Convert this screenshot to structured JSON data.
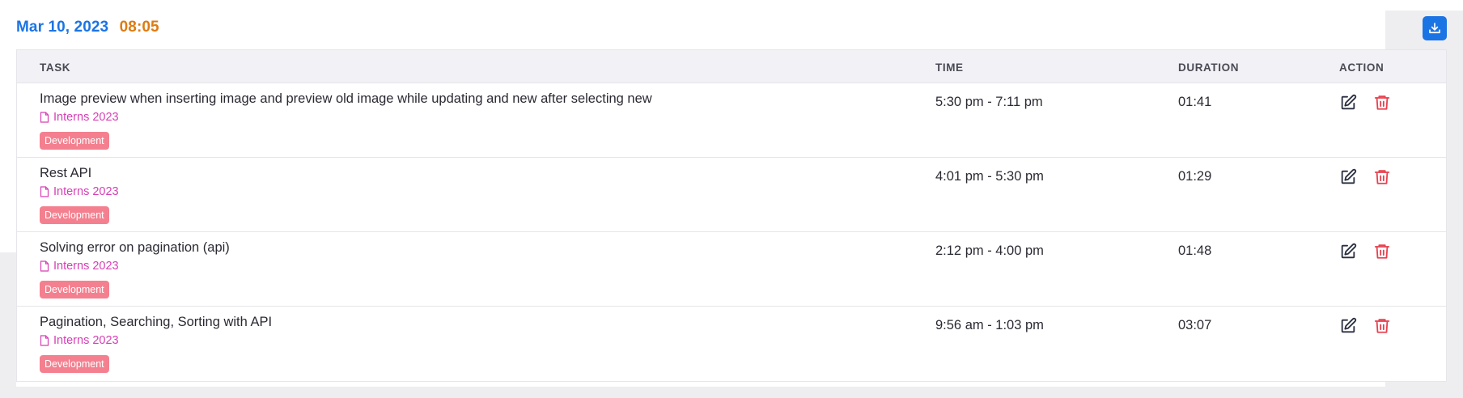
{
  "header": {
    "date": "Mar 10, 2023",
    "time": "08:05",
    "download_icon": "download-icon"
  },
  "table": {
    "columns": [
      "TASK",
      "TIME",
      "DURATION",
      "ACTION"
    ],
    "rows": [
      {
        "title": "Image preview when inserting image and preview old image while updating and new after selecting new",
        "project": "Interns 2023",
        "tag": "Development",
        "time": "5:30 pm - 7:11 pm",
        "duration": "01:41"
      },
      {
        "title": "Rest API",
        "project": "Interns 2023",
        "tag": "Development",
        "time": "4:01 pm - 5:30 pm",
        "duration": "01:29"
      },
      {
        "title": "Solving error on pagination (api)",
        "project": "Interns 2023",
        "tag": "Development",
        "time": "2:12 pm - 4:00 pm",
        "duration": "01:48"
      },
      {
        "title": "Pagination, Searching, Sorting with API",
        "project": "Interns 2023",
        "tag": "Development",
        "time": "9:56 am - 1:03 pm",
        "duration": "03:07"
      }
    ]
  },
  "colors": {
    "date": "#1b74e4",
    "time": "#de7b12",
    "project": "#d63fb5",
    "tag_bg": "#f4808f",
    "delete": "#e8414f",
    "edit": "#2a3040"
  }
}
